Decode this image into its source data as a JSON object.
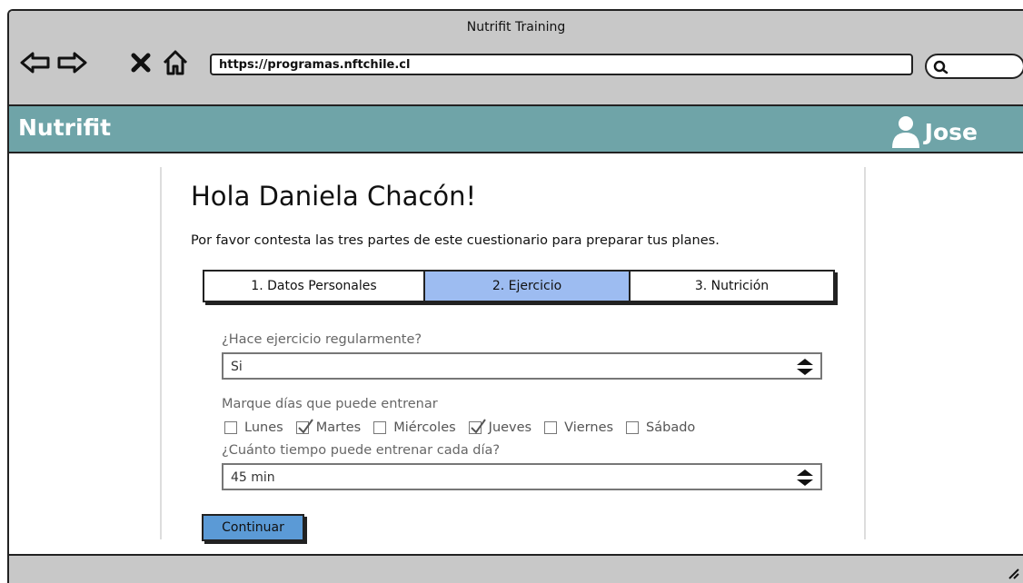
{
  "window": {
    "title": "Nutrifit Training",
    "url": "https://programas.nftchile.cl"
  },
  "app": {
    "brand": "Nutrifit",
    "user_name": "Jose"
  },
  "form": {
    "greeting": "Hola Daniela Chacón!",
    "instructions": "Por favor contesta las tres partes de este cuestionario para preparar tus planes.",
    "tabs": [
      {
        "label": "1. Datos Personales",
        "active": false
      },
      {
        "label": "2. Ejercicio",
        "active": true
      },
      {
        "label": "3. Nutrición",
        "active": false
      }
    ],
    "exercise_question": "¿Hace ejercicio regularmente?",
    "exercise_value": "Si",
    "days_label": "Marque días que puede entrenar",
    "days": [
      {
        "label": "Lunes",
        "checked": false
      },
      {
        "label": "Martes",
        "checked": true
      },
      {
        "label": "Miércoles",
        "checked": false
      },
      {
        "label": "Jueves",
        "checked": true
      },
      {
        "label": "Viernes",
        "checked": false
      },
      {
        "label": "Sábado",
        "checked": false
      }
    ],
    "time_question": "¿Cuánto tiempo puede entrenar cada día?",
    "time_value": "45 min",
    "continue_label": "Continuar"
  },
  "colors": {
    "appbar": "#6fa4a8",
    "active_tab": "#9dbcf1",
    "button": "#5b9ad6",
    "chrome": "#c8c8c8"
  }
}
